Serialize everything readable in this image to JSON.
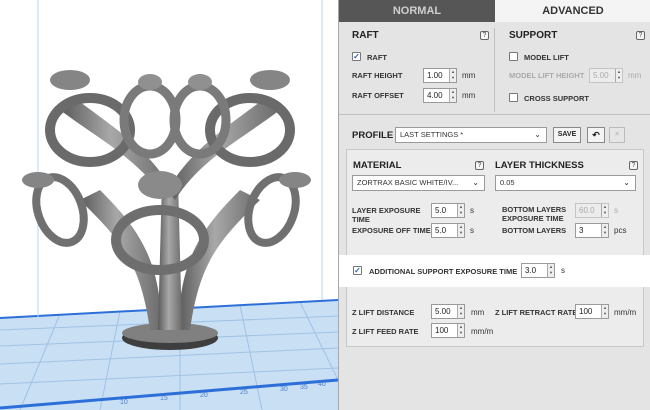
{
  "tabs": {
    "normal": "NORMAL",
    "advanced": "ADVANCED"
  },
  "raft": {
    "title": "RAFT",
    "checkbox_label": "RAFT",
    "checked": true,
    "height_label": "RAFT HEIGHT",
    "height_value": "1.00",
    "offset_label": "RAFT OFFSET",
    "offset_value": "4.00",
    "unit": "mm"
  },
  "support": {
    "title": "SUPPORT",
    "model_lift_label": "MODEL LIFT",
    "model_lift_height_label": "MODEL LIFT HEIGHT",
    "model_lift_height_value": "5.00",
    "unit": "mm",
    "cross_support_label": "CROSS SUPPORT"
  },
  "profile": {
    "label": "PROFILE",
    "selected": "LAST SETTINGS *",
    "save_label": "SAVE"
  },
  "material": {
    "label": "MATERIAL",
    "selected": "ZORTRAX BASIC WHITE/IV..."
  },
  "layer_thickness": {
    "label": "LAYER THICKNESS",
    "selected": "0.05"
  },
  "exposure": {
    "layer_exposure_label": "LAYER EXPOSURE TIME",
    "layer_exposure_value": "5.0",
    "exposure_off_label": "EXPOSURE OFF TIME",
    "exposure_off_value": "5.0",
    "bottom_exposure_label": "BOTTOM LAYERS EXPOSURE TIME",
    "bottom_exposure_value": "60.0",
    "bottom_layers_label": "BOTTOM LAYERS",
    "bottom_layers_value": "3",
    "unit_s": "s",
    "unit_pcs": "pcs"
  },
  "additional": {
    "label": "ADDITIONAL SUPPORT EXPOSURE TIME",
    "checked": true,
    "value": "3.0",
    "unit": "s"
  },
  "zlift": {
    "distance_label": "Z LIFT DISTANCE",
    "distance_value": "5.00",
    "distance_unit": "mm",
    "retract_label": "Z LIFT RETRACT RATE",
    "retract_value": "100",
    "retract_unit": "mm/m",
    "feed_label": "Z LIFT FEED RATE",
    "feed_value": "100",
    "feed_unit": "mm/m"
  },
  "icons": {
    "help": "?",
    "check": "✓",
    "spin_up": "▲",
    "spin_down": "▼",
    "dropdown": "⌄",
    "reset": "↶",
    "delete": "×"
  },
  "viewport": {
    "axis_labels": [
      "10",
      "15",
      "20",
      "25",
      "30",
      "35",
      "40"
    ]
  }
}
